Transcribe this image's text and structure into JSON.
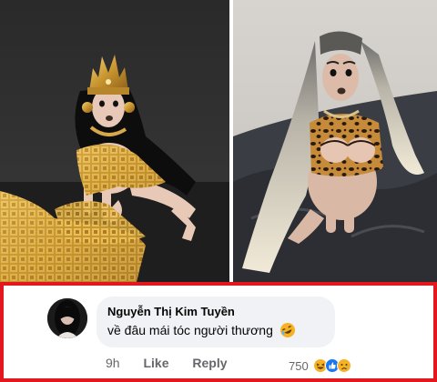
{
  "comment": {
    "author": "Nguyễn Thị Kim Tuyền",
    "text": "về đâu mái tóc người thương",
    "text_emoji_icon": "rofl-emoji-icon",
    "time": "9h",
    "like_label": "Like",
    "reply_label": "Reply",
    "reaction_count": "750",
    "reaction_icons": [
      "haha-reaction-icon",
      "like-reaction-icon",
      "sad-reaction-icon"
    ]
  },
  "colors": {
    "frame": "#e3181f",
    "bubble": "#f0f2f5",
    "muted_text": "#65676b",
    "like_blue": "#1877f2",
    "haha_yellow": "#f7b125"
  }
}
